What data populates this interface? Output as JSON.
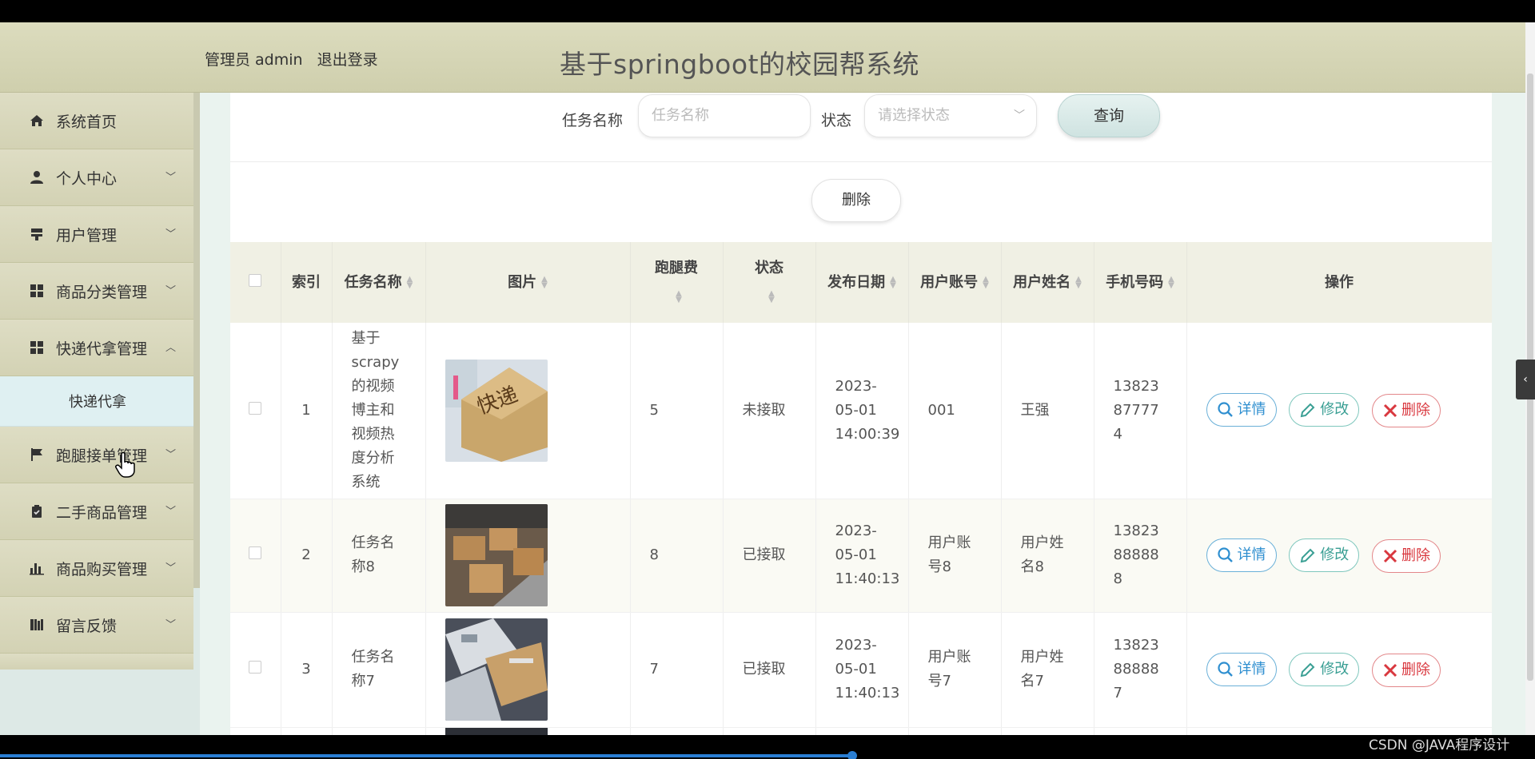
{
  "header": {
    "role": "管理员 admin",
    "logout": "退出登录",
    "title": "基于springboot的校园帮系统"
  },
  "sidebar": {
    "items": [
      {
        "label": "系统首页",
        "icon": "home-icon"
      },
      {
        "label": "个人中心",
        "icon": "user-icon"
      },
      {
        "label": "用户管理",
        "icon": "user-manage-icon"
      },
      {
        "label": "商品分类管理",
        "icon": "grid-icon"
      },
      {
        "label": "快递代拿管理",
        "icon": "grid-icon"
      },
      {
        "label": "跑腿接单管理",
        "icon": "flag-icon"
      },
      {
        "label": "二手商品管理",
        "icon": "clipboard-icon"
      },
      {
        "label": "商品购买管理",
        "icon": "bar-chart-icon"
      },
      {
        "label": "留言反馈",
        "icon": "book-icon"
      }
    ],
    "submenu_label": "快递代拿"
  },
  "search": {
    "task_name_label": "任务名称",
    "task_name_placeholder": "任务名称",
    "status_label": "状态",
    "status_placeholder": "请选择状态",
    "query_button": "查询"
  },
  "actions": {
    "delete_button": "删除"
  },
  "table": {
    "headers": {
      "index": "索引",
      "task_name": "任务名称",
      "image": "图片",
      "fee": "跑腿费",
      "status": "状态",
      "publish_date": "发布日期",
      "account": "用户账号",
      "user_name": "用户姓名",
      "phone": "手机号码",
      "operation": "操作"
    },
    "rows": [
      {
        "index": "1",
        "task_name": "基于scrapy的视频博主和视频热度分析系统",
        "fee": "5",
        "status": "未接取",
        "date": "2023-05-01 14:00:39",
        "account": "001",
        "user_name": "王强",
        "phone": "13823877774"
      },
      {
        "index": "2",
        "task_name": "任务名称8",
        "fee": "8",
        "status": "已接取",
        "date": "2023-05-01 11:40:13",
        "account": "用户账号8",
        "user_name": "用户姓名8",
        "phone": "13823888888"
      },
      {
        "index": "3",
        "task_name": "任务名称7",
        "fee": "7",
        "status": "已接取",
        "date": "2023-05-01 11:40:13",
        "account": "用户账号7",
        "user_name": "用户姓名7",
        "phone": "13823888887"
      }
    ],
    "op_labels": {
      "detail": "详情",
      "edit": "修改",
      "delete": "删除"
    }
  },
  "watermark": "CSDN @JAVA程序设计",
  "colors": {
    "header_bg": "#d6d6b8",
    "sidebar_bg": "#d8d7ba",
    "submenu_bg": "#dff0f2",
    "detail": "#2f8fd0",
    "edit": "#3a9f94",
    "delete": "#d9383f"
  }
}
